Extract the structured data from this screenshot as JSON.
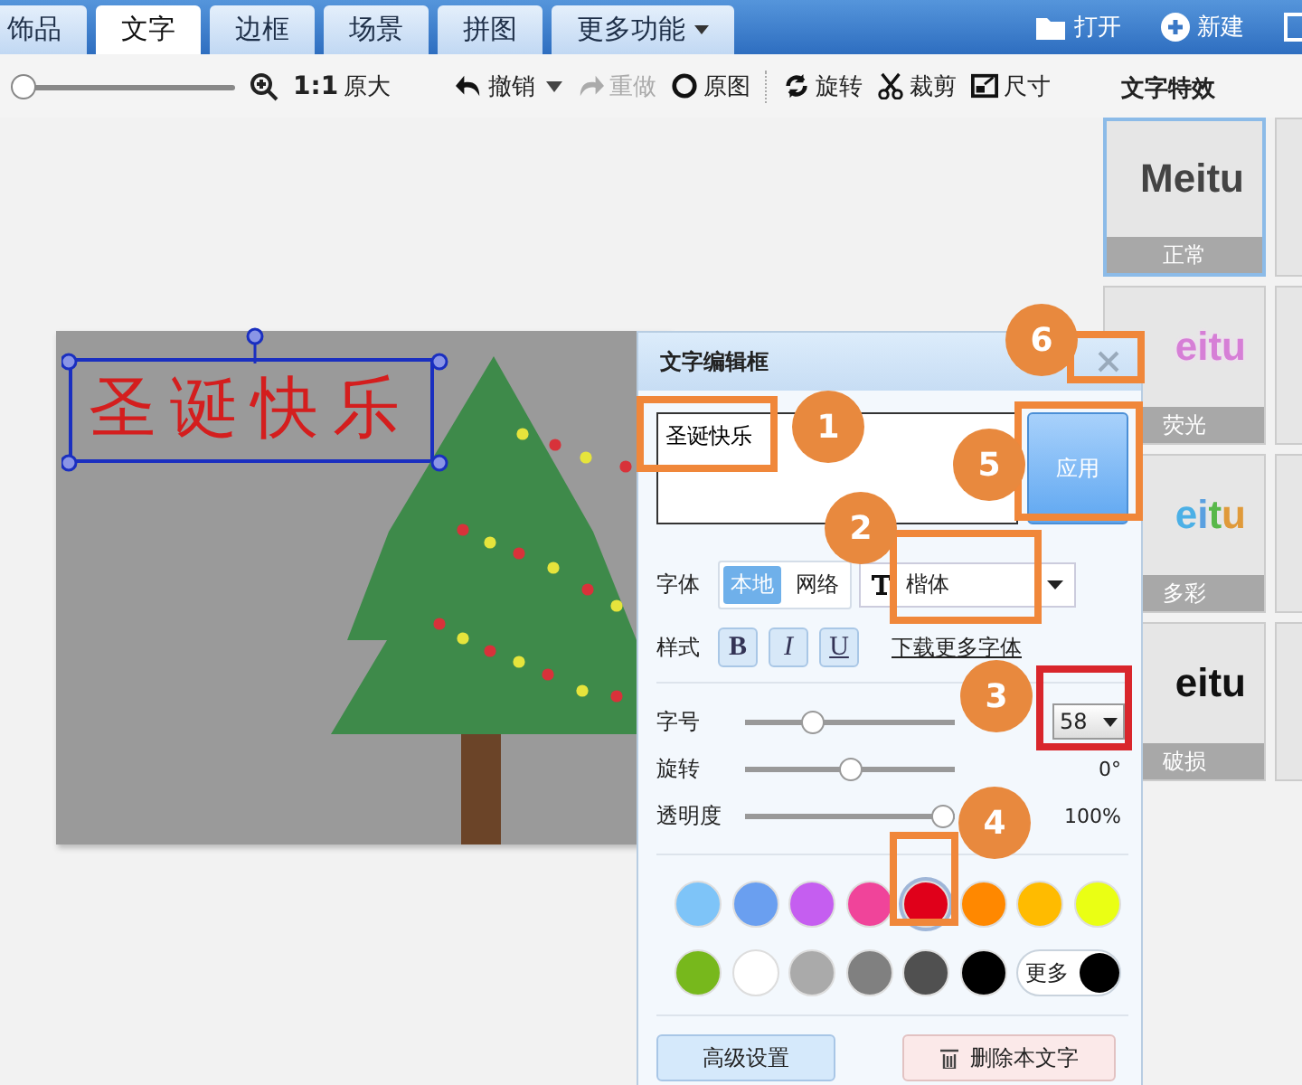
{
  "tabs": [
    {
      "label": "饰品",
      "selected": false,
      "has_menu": false
    },
    {
      "label": "文字",
      "selected": true,
      "has_menu": false
    },
    {
      "label": "边框",
      "selected": false,
      "has_menu": false
    },
    {
      "label": "场景",
      "selected": false,
      "has_menu": false
    },
    {
      "label": "拼图",
      "selected": false,
      "has_menu": false
    },
    {
      "label": "更多功能",
      "selected": false,
      "has_menu": true
    }
  ],
  "header_actions": [
    {
      "label": "打开"
    },
    {
      "label": "新建"
    }
  ],
  "toolbar": {
    "zoom_slider": {
      "level": 0
    },
    "ratio": "1:1",
    "original_size": "原大",
    "tools": [
      {
        "label": "撤销",
        "disabled": false,
        "has_menu": true
      },
      {
        "label": "重做",
        "disabled": true,
        "has_menu": false
      },
      {
        "label": "原图",
        "disabled": false,
        "has_menu": false
      },
      {
        "label": "旋转",
        "disabled": false,
        "has_menu": false
      },
      {
        "label": "裁剪",
        "disabled": false,
        "has_menu": false
      },
      {
        "label": "尺寸",
        "disabled": false,
        "has_menu": false
      }
    ]
  },
  "effects_panel": {
    "title": "文字特效",
    "tiles": [
      {
        "preview": "Meitu",
        "label": "正常",
        "kind": "normal",
        "selected": true
      },
      {
        "preview": "eitu",
        "label": "荧光",
        "kind": "glow",
        "selected": false
      },
      {
        "preview": "eitu",
        "label": "多彩",
        "kind": "colorful",
        "selected": false
      },
      {
        "preview": "eitu",
        "label": "破损",
        "kind": "broken",
        "selected": false
      }
    ]
  },
  "canvas": {
    "text_layer": "圣诞快乐"
  },
  "dialog": {
    "title": "文字编辑框",
    "text_value": "圣诞快乐",
    "apply": "应用",
    "font_label": "字体",
    "font_sources": [
      {
        "label": "本地",
        "selected": true
      },
      {
        "label": "网络",
        "selected": false
      }
    ],
    "font": "楷体",
    "style_label": "样式",
    "styles": [
      {
        "label": "B",
        "kind": "bold",
        "on": false
      },
      {
        "label": "I",
        "kind": "italic",
        "on": false
      },
      {
        "label": "U",
        "kind": "underline",
        "on": false
      }
    ],
    "download_link": "下载更多字体",
    "sliders": [
      {
        "label": "字号",
        "level": 0.3,
        "kind": "select",
        "value": "58"
      },
      {
        "label": "旋转",
        "level": 0.5,
        "kind": "reading",
        "value": "0°"
      },
      {
        "label": "透明度",
        "level": 1,
        "kind": "reading",
        "value": "100%"
      }
    ],
    "colors": [
      {
        "color": "#7ec4f8",
        "selected": false
      },
      {
        "color": "#6a9ff0",
        "selected": false
      },
      {
        "color": "#c55ef0",
        "selected": false
      },
      {
        "color": "#f0449a",
        "selected": false
      },
      {
        "color": "#e0001a",
        "selected": true
      },
      {
        "color": "#ff8800",
        "selected": false
      },
      {
        "color": "#ffbb00",
        "selected": false
      },
      {
        "color": "#eaff14",
        "selected": false
      },
      {
        "color": "#77b81c",
        "selected": false
      },
      {
        "color": "#ffffff",
        "selected": false
      },
      {
        "color": "#aaaaaa",
        "selected": false
      },
      {
        "color": "#808080",
        "selected": false
      },
      {
        "color": "#505050",
        "selected": false
      },
      {
        "color": "#000000",
        "selected": false
      }
    ],
    "more_colors": "更多",
    "advanced": "高级设置",
    "delete": "删除本文字"
  },
  "annotations": [
    {
      "number": "6",
      "color": "#f0873a"
    },
    {
      "number": "1",
      "color": "#f0873a"
    },
    {
      "number": "5",
      "color": "#f0873a"
    },
    {
      "number": "2",
      "color": "#f0873a"
    },
    {
      "number": "3",
      "color": "#d9262c"
    },
    {
      "number": "4",
      "color": "#f0873a"
    }
  ]
}
